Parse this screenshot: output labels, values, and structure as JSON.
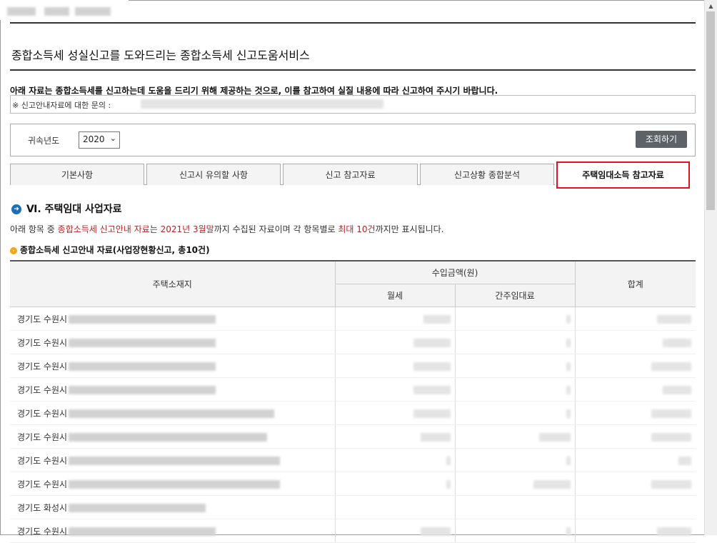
{
  "page": {
    "title": "종합소득세 성실신고를 도와드리는 종합소득세 신고도움서비스",
    "notice": "아래 자료는 종합소득세를 신고하는데 도움을 드리기 위해 제공하는 것으로, 이를 참고하여 실질 내용에 따라 신고하여 주시기 바랍니다.",
    "inquiry_label": "※ 신고안내자료에 대한 문의 :"
  },
  "filter": {
    "year_label": "귀속년도",
    "year_value": "2020",
    "search_label": "조회하기"
  },
  "tabs": [
    {
      "label": "기본사항",
      "active": false
    },
    {
      "label": "신고시 유의할 사항",
      "active": false
    },
    {
      "label": "신고 참고자료",
      "active": false
    },
    {
      "label": "신고상황 종합분석",
      "active": false
    },
    {
      "label": "주택임대소득 참고자료",
      "active": true
    }
  ],
  "section": {
    "number": "Ⅵ.",
    "heading": "주택임대 사업자료",
    "desc_1": "아래 항목 중 ",
    "desc_red_1": "종합소득세 신고안내 자료",
    "desc_2": "는 ",
    "desc_red_2": "2021년 3월말",
    "desc_3": "까지 수집된 자료이며 각 항목별로 ",
    "desc_red_3": "최대 10건",
    "desc_4": "까지만 표시됩니다.",
    "subheading": "종합소득세 신고안내 자료(사업장현황신고, 총10건)"
  },
  "table": {
    "headers": {
      "address": "주택소재지",
      "income_group": "수입금액(원)",
      "monthly_rent": "월세",
      "deemed_rent": "간주임대료",
      "total": "합계"
    },
    "rows": [
      {
        "address": "경기도 수원시"
      },
      {
        "address": "경기도 수원시"
      },
      {
        "address": "경기도 수원시"
      },
      {
        "address": "경기도 수원시"
      },
      {
        "address": "경기도 수원시"
      },
      {
        "address": "경기도 수원시"
      },
      {
        "address": "경기도 수원시"
      },
      {
        "address": "경기도 수원시"
      },
      {
        "address": "경기도 화성시"
      },
      {
        "address": "경기도 수원시"
      }
    ]
  },
  "icons": {
    "section_icon": "arrow-circle-icon",
    "subsection_icon": "orange-arrow-icon",
    "select_icon": "chevron-down-icon",
    "scroll_icon": "scroll-up-arrow-icon"
  },
  "colors": {
    "accent_red": "#e0141e",
    "text_red": "#b42424",
    "button_bg": "#5d6168",
    "section_icon": "#1e6fb7",
    "sub_icon": "#f2a516"
  }
}
